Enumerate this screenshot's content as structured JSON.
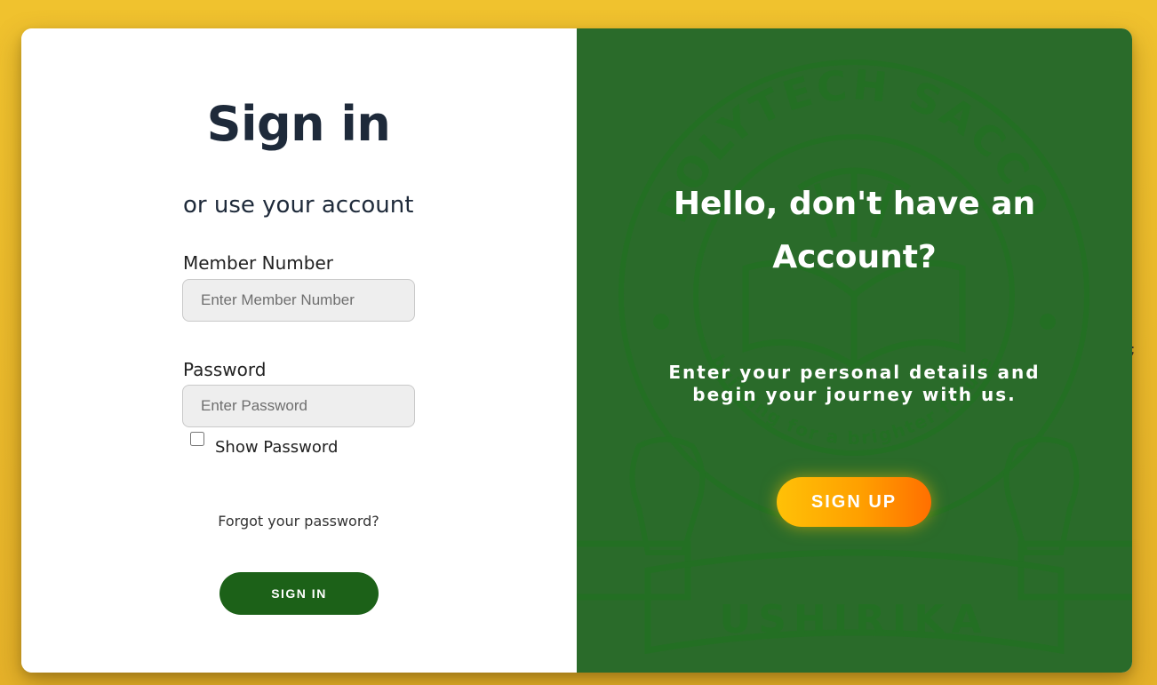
{
  "signin": {
    "title": "Sign in",
    "subtitle": "or use your account",
    "member_number": {
      "label": "Member Number",
      "placeholder": "Enter Member Number",
      "value": ""
    },
    "password": {
      "label": "Password",
      "placeholder": "Enter Password",
      "value": ""
    },
    "show_password": {
      "label": "Show Password",
      "checked": false
    },
    "forgot_link": "Forgot your password?",
    "submit_label": "SIGN IN"
  },
  "signup": {
    "heading": "Hello, don't have an Account?",
    "text": "Enter your personal details and begin your journey with us.",
    "button_label": "SIGN UP"
  },
  "watermark": {
    "ring_text": "POLYTECH SACCO",
    "motto_text": "building for a brighter future",
    "banner_text": "USHIRIKA"
  },
  "stray_mark": ";",
  "colors": {
    "page_background": "#f0c22e",
    "primary_green": "#1c6118",
    "panel_green": "#2a6b2a",
    "signup_gradient_start": "#ffc107",
    "signup_gradient_end": "#ff6f00",
    "heading_text": "#1e2a3a"
  }
}
